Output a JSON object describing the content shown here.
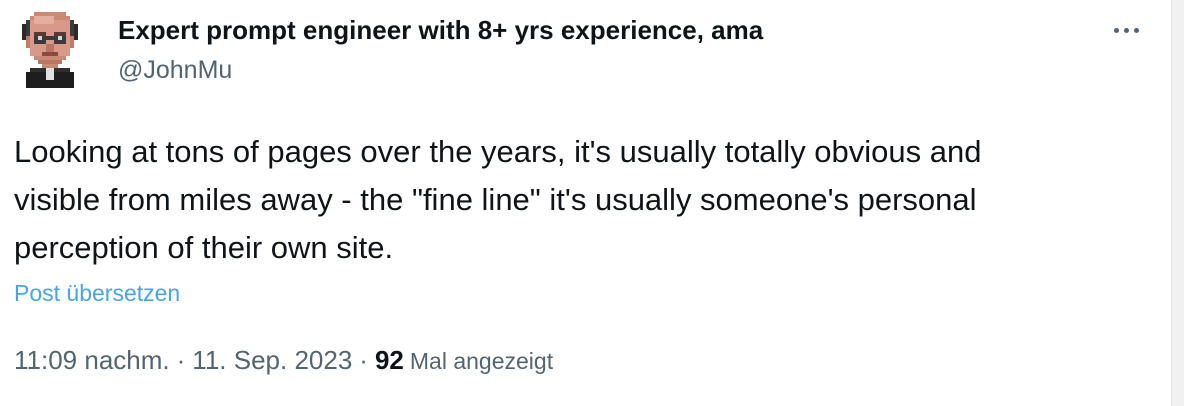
{
  "author": {
    "name": "Expert prompt engineer with 8+ yrs experience, ama",
    "handle": "@JohnMu"
  },
  "tweet": {
    "text_lines": [
      "Looking at tons of pages over the years, it's usually totally obvious and",
      "visible from miles away - the \"fine line\" it's usually someone's personal",
      "perception of their own site."
    ],
    "translate_label": "Post übersetzen"
  },
  "meta": {
    "time": "11:09 nachm.",
    "separator": "·",
    "date": "11. Sep. 2023",
    "views_count": "92",
    "views_label": "Mal angezeigt"
  },
  "icons": {
    "avatar": "pixel-art-portrait",
    "more": "more-horizontal-icon"
  },
  "colors": {
    "text_primary": "#0f1419",
    "text_secondary": "#536471",
    "link": "#4aa3e8"
  }
}
